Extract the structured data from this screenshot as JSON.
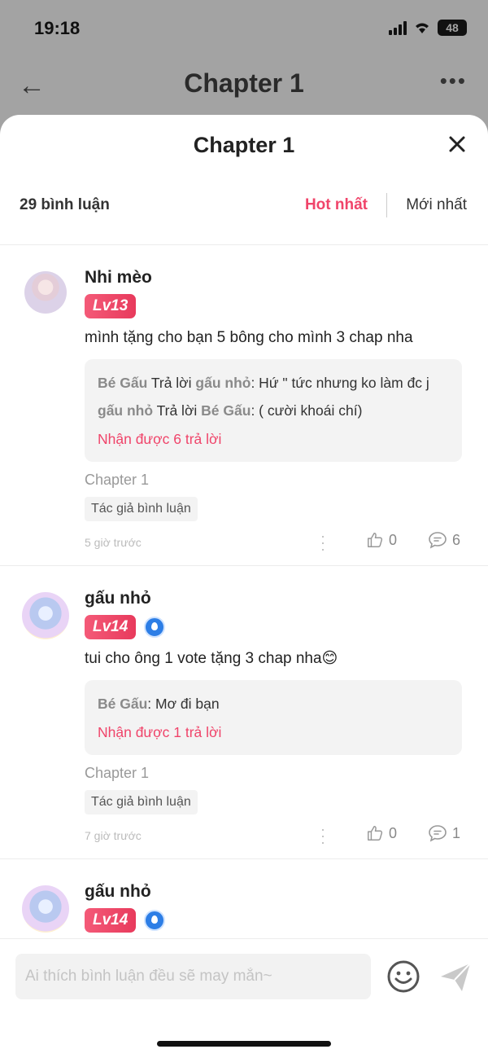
{
  "status": {
    "time": "19:18",
    "battery": "48"
  },
  "background_nav": {
    "title": "Chapter 1"
  },
  "sheet": {
    "title": "Chapter 1",
    "comment_count": "29 bình luận",
    "sort_hot": "Hot nhất",
    "sort_new": "Mới nhất"
  },
  "comments": [
    {
      "username": "Nhi mèo",
      "level": "Lv13",
      "text": "mình tặng cho bạn 5 bông cho mình 3 chap nha",
      "replies": [
        {
          "from": "Bé Gấu",
          "verb": " Trả lời ",
          "to": "gấu nhỏ",
          "text": ": Hứ \" tức nhưng ko làm đc j"
        },
        {
          "from": "gấu nhỏ",
          "verb": " Trả lời ",
          "to": "Bé Gấu",
          "text": ": ( cười khoái chí)"
        }
      ],
      "more_replies": "Nhận được 6 trả lời",
      "chapter": "Chapter 1",
      "tag": "Tác giả bình luận",
      "time": "5 giờ trước",
      "likes": "0",
      "reply_count": "6"
    },
    {
      "username": "gấu nhỏ",
      "level": "Lv14",
      "text": "tui cho ông 1 vote tặng 3 chap nha😊",
      "replies": [
        {
          "from": "Bé Gấu",
          "text": ": Mơ đi bạn"
        }
      ],
      "more_replies": "Nhận được 1 trả lời",
      "chapter": "Chapter 1",
      "tag": "Tác giả bình luận",
      "time": "7 giờ trước",
      "likes": "0",
      "reply_count": "1"
    },
    {
      "username": "gấu nhỏ",
      "level": "Lv14"
    }
  ],
  "input": {
    "placeholder": "Ai thích bình luận đều sẽ may mắn~"
  }
}
